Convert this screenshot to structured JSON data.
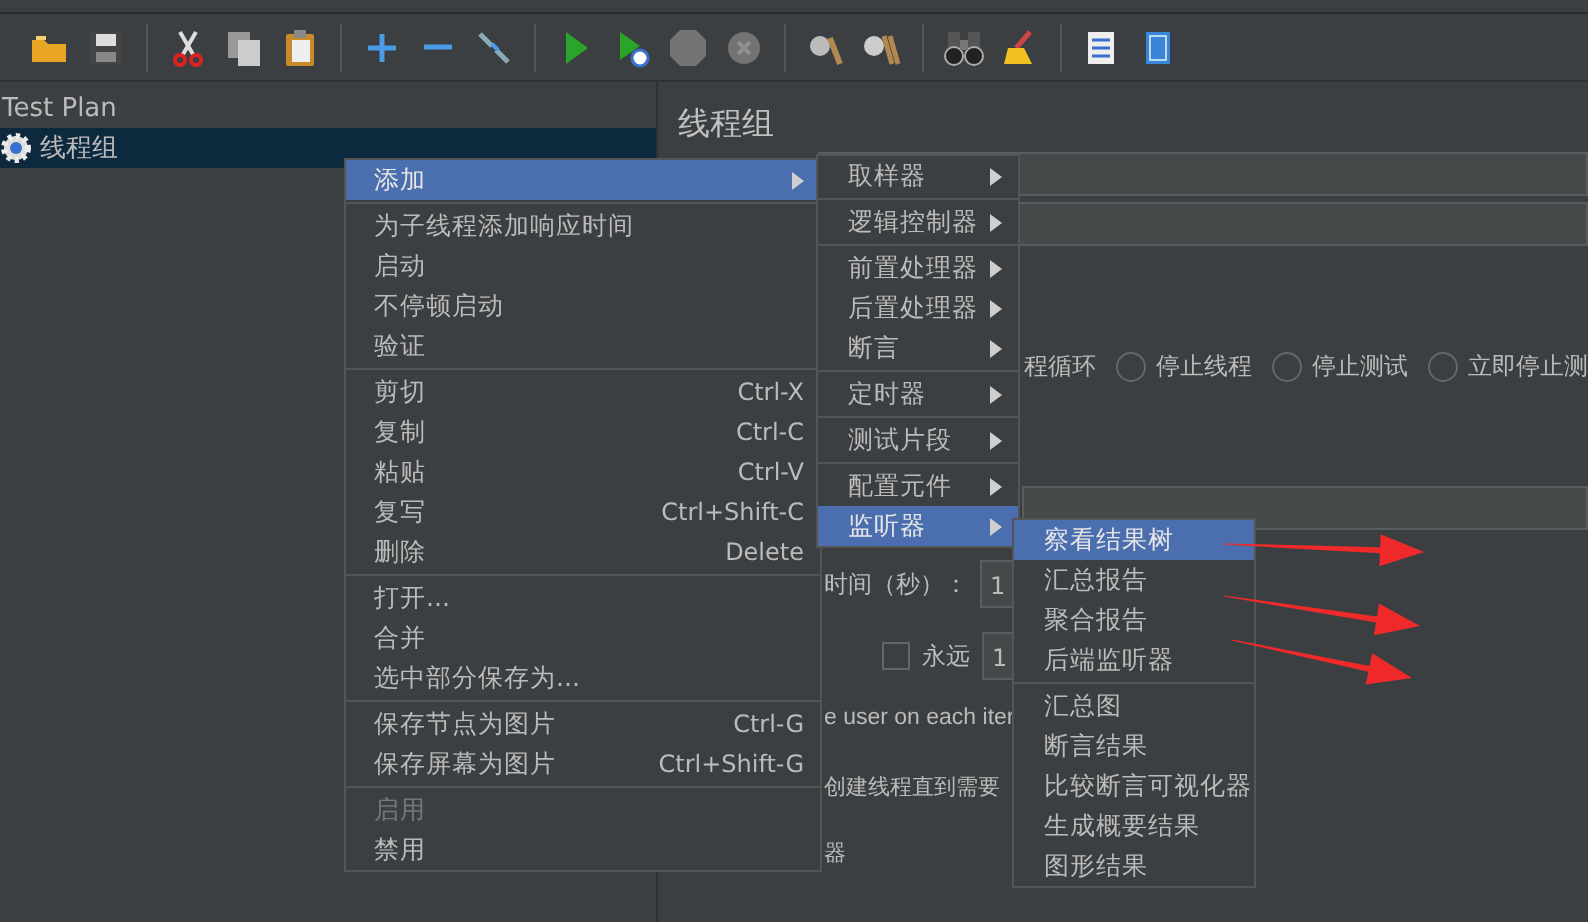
{
  "toolbar": [
    {
      "buttons": [
        {
          "kind": "open",
          "disabled": false
        },
        {
          "kind": "save",
          "disabled": false
        }
      ]
    },
    {
      "buttons": [
        {
          "kind": "cut",
          "disabled": false
        },
        {
          "kind": "copy",
          "disabled": false
        },
        {
          "kind": "paste",
          "disabled": false
        }
      ]
    },
    {
      "buttons": [
        {
          "kind": "expand",
          "disabled": false
        },
        {
          "kind": "collapse",
          "disabled": false
        },
        {
          "kind": "toggle",
          "disabled": false
        }
      ]
    },
    {
      "buttons": [
        {
          "kind": "start",
          "disabled": false
        },
        {
          "kind": "start-no-pause",
          "disabled": false
        },
        {
          "kind": "stop",
          "disabled": true
        },
        {
          "kind": "shutdown",
          "disabled": true
        }
      ]
    },
    {
      "buttons": [
        {
          "kind": "clear",
          "disabled": false
        },
        {
          "kind": "clear-all",
          "disabled": false
        }
      ]
    },
    {
      "buttons": [
        {
          "kind": "search",
          "disabled": false
        },
        {
          "kind": "reset",
          "disabled": false
        }
      ]
    },
    {
      "buttons": [
        {
          "kind": "functions",
          "disabled": false
        },
        {
          "kind": "help",
          "disabled": false
        }
      ]
    }
  ],
  "tree": {
    "header": "Test Plan",
    "items": [
      {
        "label": "线程组",
        "selected": true
      }
    ]
  },
  "panel": {
    "title": "线程组",
    "on_error_fragment": "程循环",
    "radios": [
      {
        "label": "停止线程",
        "selected": false
      },
      {
        "label": "停止测试",
        "selected": false
      },
      {
        "label": "立即停止测",
        "selected": false
      }
    ],
    "ramp_label": "时间（秒）：",
    "ramp_value": "1",
    "forever": {
      "label": "永远",
      "checked": false
    },
    "loop_value": "1",
    "same_user_fragment": "e user on each iter",
    "delay_fragment": "创建线程直到需要",
    "scheduler_fragment": "器"
  },
  "context_menu": {
    "groups": [
      {
        "items": [
          {
            "label": "添加",
            "submenu": true,
            "selected": true,
            "disabled": false
          }
        ]
      },
      {
        "items": [
          {
            "label": "为子线程添加响应时间",
            "submenu": false,
            "selected": false,
            "disabled": false
          },
          {
            "label": "启动",
            "submenu": false,
            "selected": false,
            "disabled": false
          },
          {
            "label": "不停顿启动",
            "submenu": false,
            "selected": false,
            "disabled": false
          },
          {
            "label": "验证",
            "submenu": false,
            "selected": false,
            "disabled": false
          }
        ]
      },
      {
        "items": [
          {
            "label": "剪切",
            "shortcut": "Ctrl-X",
            "submenu": false,
            "selected": false,
            "disabled": false
          },
          {
            "label": "复制",
            "shortcut": "Ctrl-C",
            "submenu": false,
            "selected": false,
            "disabled": false
          },
          {
            "label": "粘贴",
            "shortcut": "Ctrl-V",
            "submenu": false,
            "selected": false,
            "disabled": false
          },
          {
            "label": "复写",
            "shortcut": "Ctrl+Shift-C",
            "submenu": false,
            "selected": false,
            "disabled": false
          },
          {
            "label": "删除",
            "shortcut": "Delete",
            "submenu": false,
            "selected": false,
            "disabled": false
          }
        ]
      },
      {
        "items": [
          {
            "label": "打开...",
            "submenu": false,
            "selected": false,
            "disabled": false
          },
          {
            "label": "合并",
            "submenu": false,
            "selected": false,
            "disabled": false
          },
          {
            "label": "选中部分保存为...",
            "submenu": false,
            "selected": false,
            "disabled": false
          }
        ]
      },
      {
        "items": [
          {
            "label": "保存节点为图片",
            "shortcut": "Ctrl-G",
            "submenu": false,
            "selected": false,
            "disabled": false
          },
          {
            "label": "保存屏幕为图片",
            "shortcut": "Ctrl+Shift-G",
            "submenu": false,
            "selected": false,
            "disabled": false
          }
        ]
      },
      {
        "items": [
          {
            "label": "启用",
            "submenu": false,
            "selected": false,
            "disabled": true
          },
          {
            "label": "禁用",
            "submenu": false,
            "selected": false,
            "disabled": false
          }
        ]
      }
    ]
  },
  "add_submenu": {
    "groups": [
      {
        "items": [
          {
            "label": "取样器",
            "submenu": true,
            "selected": false
          }
        ]
      },
      {
        "items": [
          {
            "label": "逻辑控制器",
            "submenu": true,
            "selected": false
          }
        ]
      },
      {
        "items": [
          {
            "label": "前置处理器",
            "submenu": true,
            "selected": false
          },
          {
            "label": "后置处理器",
            "submenu": true,
            "selected": false
          },
          {
            "label": "断言",
            "submenu": true,
            "selected": false
          }
        ]
      },
      {
        "items": [
          {
            "label": "定时器",
            "submenu": true,
            "selected": false
          }
        ]
      },
      {
        "items": [
          {
            "label": "测试片段",
            "submenu": true,
            "selected": false
          }
        ]
      },
      {
        "items": [
          {
            "label": "配置元件",
            "submenu": true,
            "selected": false
          },
          {
            "label": "监听器",
            "submenu": true,
            "selected": true
          }
        ]
      }
    ]
  },
  "listener_submenu": {
    "groups": [
      {
        "items": [
          {
            "label": "察看结果树",
            "submenu": false,
            "selected": true
          },
          {
            "label": "汇总报告",
            "submenu": false,
            "selected": false
          },
          {
            "label": "聚合报告",
            "submenu": false,
            "selected": false
          },
          {
            "label": "后端监听器",
            "submenu": false,
            "selected": false
          }
        ]
      },
      {
        "items": [
          {
            "label": "汇总图",
            "submenu": false,
            "selected": false
          },
          {
            "label": "断言结果",
            "submenu": false,
            "selected": false
          },
          {
            "label": "比较断言可视化器",
            "submenu": false,
            "selected": false
          },
          {
            "label": "生成概要结果",
            "submenu": false,
            "selected": false
          },
          {
            "label": "图形结果",
            "submenu": false,
            "selected": false
          }
        ]
      }
    ]
  },
  "annotations": [
    {
      "kind": "arrow"
    },
    {
      "kind": "arrow"
    },
    {
      "kind": "arrow"
    }
  ]
}
